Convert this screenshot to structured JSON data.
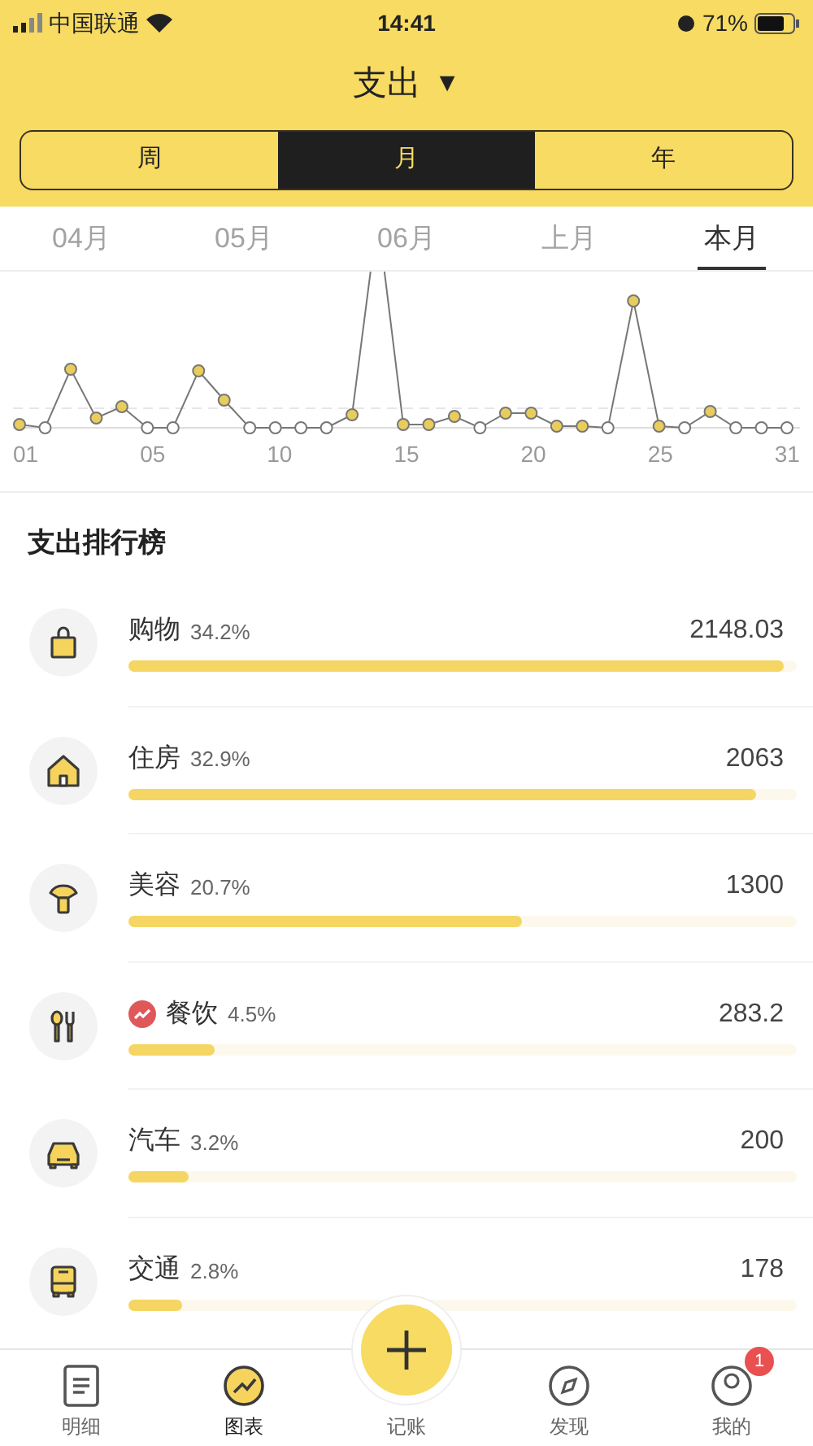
{
  "status_bar": {
    "carrier": "中国联通",
    "time": "14:41",
    "battery": "71%"
  },
  "header": {
    "title": "支出",
    "caret": "▼"
  },
  "period_tabs": [
    {
      "label": "周",
      "selected": false
    },
    {
      "label": "月",
      "selected": true
    },
    {
      "label": "年",
      "selected": false
    }
  ],
  "month_tabs": [
    {
      "label": "04月",
      "selected": false
    },
    {
      "label": "05月",
      "selected": false
    },
    {
      "label": "06月",
      "selected": false
    },
    {
      "label": "上月",
      "selected": false
    },
    {
      "label": "本月",
      "selected": true
    }
  ],
  "chart": {
    "kind": "picture",
    "x_labels": [
      "01",
      "05",
      "10",
      "15",
      "20",
      "25",
      "31"
    ]
  },
  "ranking": {
    "title": "支出排行榜",
    "items": [
      {
        "kind": "bag",
        "name": "购物",
        "percent": "34.2%",
        "amount": "2148.03",
        "level": 0.98,
        "trending": false
      },
      {
        "kind": "house",
        "name": "住房",
        "percent": "32.9%",
        "amount": "2063",
        "level": 0.94,
        "trending": false
      },
      {
        "kind": "beauty",
        "name": "美容",
        "percent": "20.7%",
        "amount": "1300",
        "level": 0.59,
        "trending": false
      },
      {
        "kind": "food",
        "name": "餐饮",
        "percent": "4.5%",
        "amount": "283.2",
        "level": 0.13,
        "trending": true
      },
      {
        "kind": "car",
        "name": "汽车",
        "percent": "3.2%",
        "amount": "200",
        "level": 0.09,
        "trending": false
      },
      {
        "kind": "bus",
        "name": "交通",
        "percent": "2.8%",
        "amount": "178",
        "level": 0.08,
        "trending": false
      }
    ]
  },
  "tab_bar": [
    {
      "kind": "list",
      "label": "明细",
      "selected": false
    },
    {
      "kind": "chart",
      "label": "图表",
      "selected": true
    },
    {
      "kind": "plus",
      "label": "记账",
      "selected": false
    },
    {
      "kind": "compass",
      "label": "发现",
      "selected": false
    },
    {
      "kind": "user",
      "label": "我的",
      "selected": false,
      "badge": "1"
    }
  ]
}
